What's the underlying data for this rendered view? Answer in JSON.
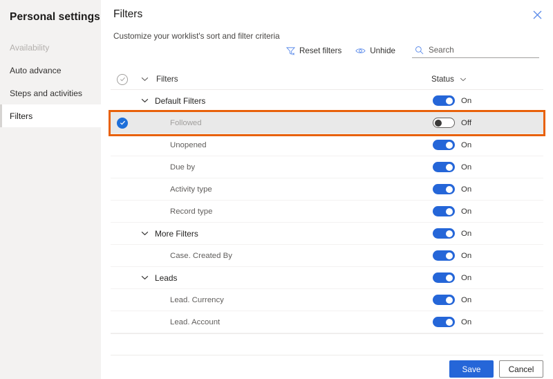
{
  "sidebar": {
    "title": "Personal settings",
    "items": [
      {
        "label": "Availability",
        "state": "disabled"
      },
      {
        "label": "Auto advance",
        "state": "normal"
      },
      {
        "label": "Steps and activities",
        "state": "normal"
      },
      {
        "label": "Filters",
        "state": "active"
      }
    ]
  },
  "panel": {
    "title": "Filters",
    "subtitle": "Customize your worklist's sort and filter criteria",
    "close_icon": "close-icon"
  },
  "commandbar": {
    "reset_filters_label": "Reset filters",
    "reset_filters_icon": "filter-reset-icon",
    "unhide_label": "Unhide",
    "unhide_icon": "eye-icon",
    "search_icon": "search-icon",
    "search_placeholder": "Search",
    "search_value": ""
  },
  "grid": {
    "header": {
      "select_icon": "circle-check-outline-icon",
      "chevron_icon": "chevron-down-icon",
      "name_column": "Filters",
      "status_column": "Status",
      "status_chevron_icon": "chevron-down-icon"
    },
    "rows": [
      {
        "label": "Default Filters",
        "type": "group",
        "status": "On",
        "toggle": "on",
        "selected": false,
        "highlighted": false,
        "chevron": "chevron-down-icon"
      },
      {
        "label": "Followed",
        "type": "child",
        "status": "Off",
        "toggle": "off",
        "selected": true,
        "highlighted": true,
        "chevron": ""
      },
      {
        "label": "Unopened",
        "type": "child",
        "status": "On",
        "toggle": "on",
        "selected": false,
        "highlighted": false,
        "chevron": ""
      },
      {
        "label": "Due by",
        "type": "child",
        "status": "On",
        "toggle": "on",
        "selected": false,
        "highlighted": false,
        "chevron": ""
      },
      {
        "label": "Activity type",
        "type": "child",
        "status": "On",
        "toggle": "on",
        "selected": false,
        "highlighted": false,
        "chevron": ""
      },
      {
        "label": "Record type",
        "type": "child",
        "status": "On",
        "toggle": "on",
        "selected": false,
        "highlighted": false,
        "chevron": ""
      },
      {
        "label": "More Filters",
        "type": "group",
        "status": "On",
        "toggle": "on",
        "selected": false,
        "highlighted": false,
        "chevron": "chevron-down-icon"
      },
      {
        "label": "Case. Created By",
        "type": "child",
        "status": "On",
        "toggle": "on",
        "selected": false,
        "highlighted": false,
        "chevron": ""
      },
      {
        "label": "Leads",
        "type": "group",
        "status": "On",
        "toggle": "on",
        "selected": false,
        "highlighted": false,
        "chevron": "chevron-down-icon"
      },
      {
        "label": "Lead. Currency",
        "type": "child",
        "status": "On",
        "toggle": "on",
        "selected": false,
        "highlighted": false,
        "chevron": ""
      },
      {
        "label": "Lead. Account",
        "type": "child",
        "status": "On",
        "toggle": "on",
        "selected": false,
        "highlighted": false,
        "chevron": ""
      }
    ]
  },
  "footer": {
    "save_label": "Save",
    "cancel_label": "Cancel"
  },
  "colors": {
    "accent_blue": "#2566d8",
    "highlight_orange": "#e8610a",
    "sidebar_bg": "#f3f2f1",
    "selected_row_bg": "#e9e9e9"
  }
}
